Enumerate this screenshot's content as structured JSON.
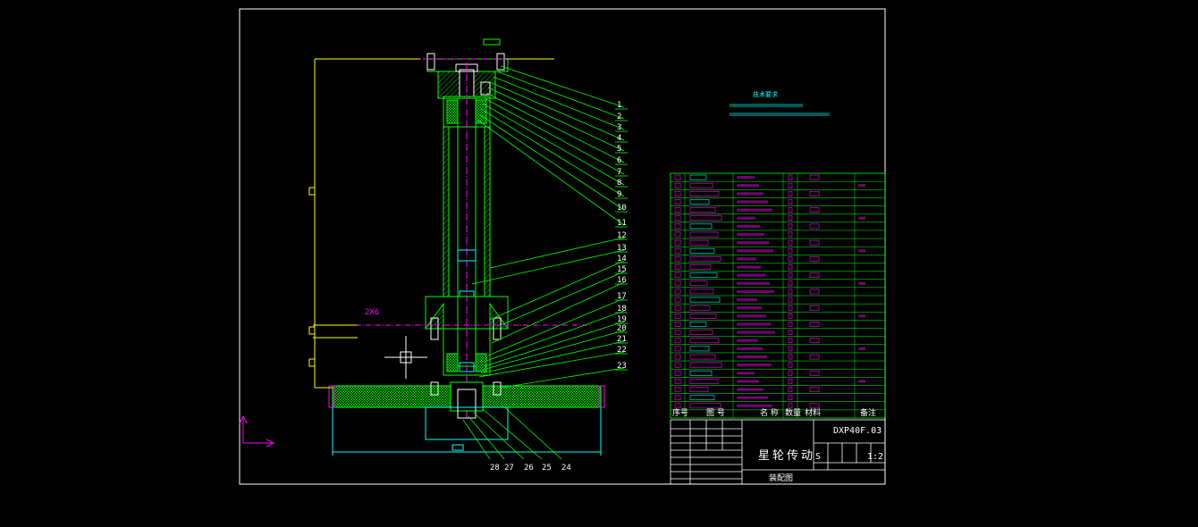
{
  "drawing": {
    "title": "星轮传动",
    "drawing_number": "DXP40F.03",
    "drawing_type": "装配图",
    "scale": "1:2",
    "sheet_mark": "S",
    "tech_requirements_title": "技术要求",
    "dimension_tag": "2X6",
    "parts_header": [
      "序号",
      "图 号",
      "名 称",
      "数量",
      "材料",
      "备注"
    ],
    "leader_numbers": [
      "1",
      "2",
      "3",
      "4",
      "5",
      "6",
      "7",
      "8",
      "9",
      "10",
      "11",
      "12",
      "13",
      "14",
      "15",
      "16",
      "17",
      "18",
      "19",
      "20",
      "21",
      "22",
      "23",
      "24",
      "25",
      "26",
      "27",
      "28"
    ]
  },
  "colors": {
    "frame": "#ffffff",
    "part_outline": "#00ff00",
    "center_line": "#ff00ff",
    "hidden": "#00ffff",
    "dimension": "#ffff00",
    "bolt": "#ffffff",
    "hatch": "#00ff00",
    "magenta": "#ff00ff",
    "cyan": "#00ffff"
  }
}
